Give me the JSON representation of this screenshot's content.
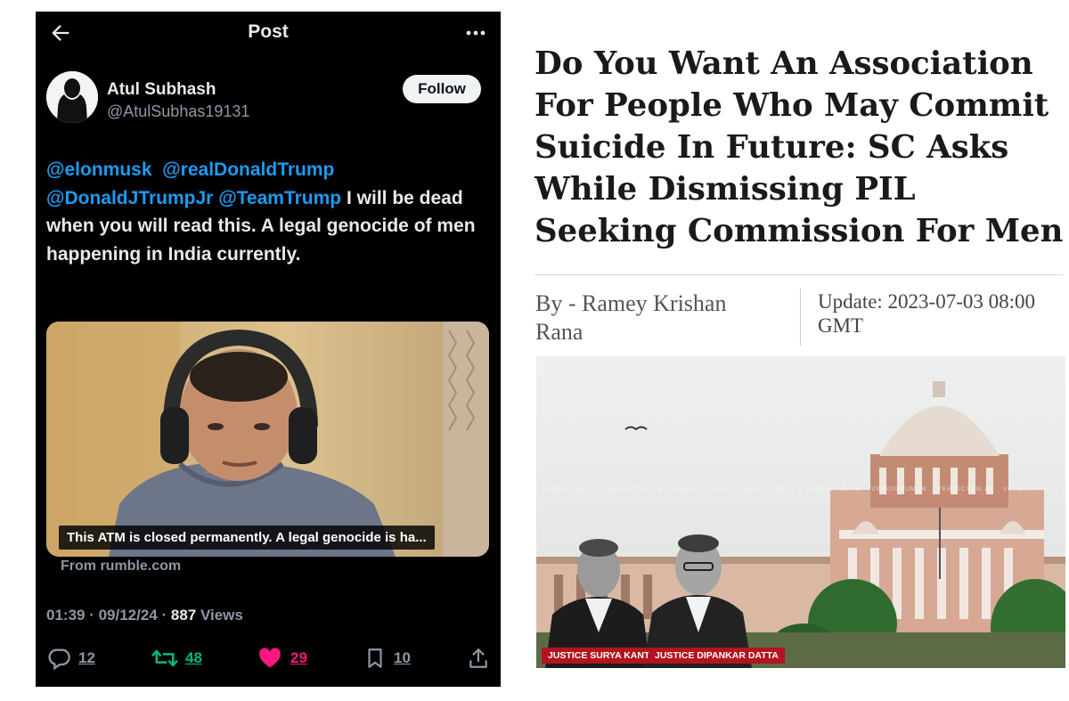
{
  "post": {
    "header_title": "Post",
    "user": {
      "name": "Atul Subhash",
      "handle": "@AtulSubhas19131"
    },
    "follow_label": "Follow",
    "text": {
      "mention1": "@elonmusk",
      "mention2": "@realDonaldTrump",
      "mention3": "@DonaldJTrumpJr",
      "mention4": "@TeamTrump",
      "body": " I will be dead when you will read this. A legal genocide of men happening in India currently."
    },
    "video_caption": "This ATM is closed permanently. A legal genocide is ha...",
    "media_source": "From rumble.com",
    "timestamp": "01:39 · 09/12/24 · ",
    "views_count": "887",
    "views_label": " Views",
    "actions": {
      "replies": "12",
      "reposts": "48",
      "likes": "29",
      "bookmarks": "10"
    },
    "colors": {
      "link": "#1d9bf0",
      "repost": "#00ba7c",
      "like": "#f91880"
    }
  },
  "article": {
    "headline": "Do You Want An Association For People Who May Commit Suicide In Future: SC Asks While Dismissing PIL Seeking Commission For Men",
    "byline": "By - Ramey Krishan Rana",
    "update": "Update: 2023-07-03 08:00 GMT",
    "watermark": "VERDICTUM.IN",
    "justice_left": "JUSTICE SURYA KANT",
    "justice_right": "JUSTICE DIPANKAR DATTA"
  }
}
